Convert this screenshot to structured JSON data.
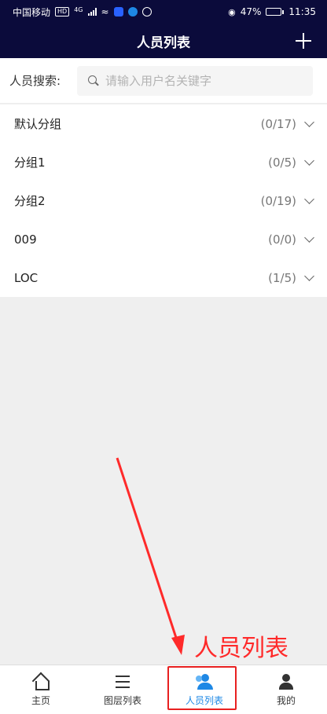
{
  "status_bar": {
    "carrier": "中国移动",
    "hd_tag": "HD",
    "network": "4G",
    "battery_percent": "47%",
    "time": "11:35",
    "battery_level": 0.47
  },
  "header": {
    "title": "人员列表",
    "add_icon": "plus-icon"
  },
  "search": {
    "label": "人员搜索:",
    "placeholder": "请输入用户名关键字",
    "value": ""
  },
  "groups": [
    {
      "name": "默认分组",
      "count": "(0/17)"
    },
    {
      "name": "分组1",
      "count": "(0/5)"
    },
    {
      "name": "分组2",
      "count": "(0/19)"
    },
    {
      "name": "009",
      "count": "(0/0)"
    },
    {
      "name": "LOC",
      "count": "(1/5)"
    }
  ],
  "annotation": {
    "text": "人员列表",
    "color": "#ff2a2a"
  },
  "bottom_nav": [
    {
      "label": "主页",
      "icon": "home-icon"
    },
    {
      "label": "图层列表",
      "icon": "layers-icon"
    },
    {
      "label": "人员列表",
      "icon": "people-icon",
      "active": true
    },
    {
      "label": "我的",
      "icon": "person-icon"
    }
  ],
  "colors": {
    "header_bg": "#0b0b3b",
    "accent": "#1e88e5",
    "annotation": "#ff2a2a"
  }
}
